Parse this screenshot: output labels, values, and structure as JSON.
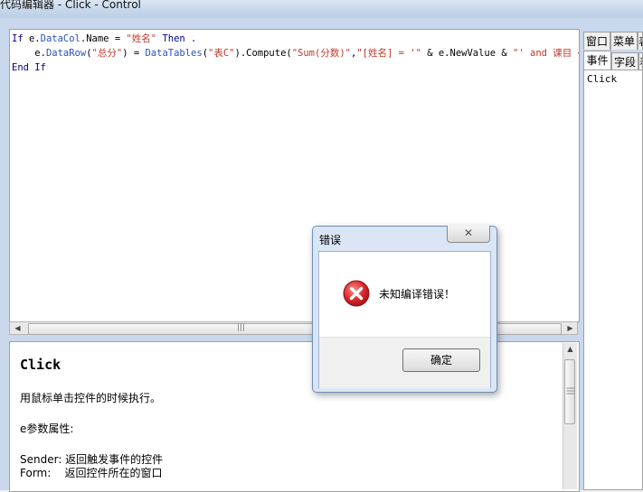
{
  "window": {
    "title": "代码编辑器 - Click - Control"
  },
  "editor": {
    "lines": [
      [
        {
          "t": "If ",
          "c": "kw"
        },
        {
          "t": "e",
          "c": ""
        },
        {
          "t": ".",
          "c": ""
        },
        {
          "t": "DataCol",
          "c": "id"
        },
        {
          "t": ".Name = ",
          "c": ""
        },
        {
          "t": "\"姓名\"",
          "c": "str"
        },
        {
          "t": " Then .",
          "c": "kw"
        }
      ],
      [
        {
          "t": "    e.",
          "c": ""
        },
        {
          "t": "DataRow",
          "c": "id"
        },
        {
          "t": "(",
          "c": ""
        },
        {
          "t": "\"总分\"",
          "c": "str"
        },
        {
          "t": ") = ",
          "c": ""
        },
        {
          "t": "DataTables",
          "c": "id"
        },
        {
          "t": "(",
          "c": ""
        },
        {
          "t": "\"表C\"",
          "c": "str"
        },
        {
          "t": ").Compute(",
          "c": ""
        },
        {
          "t": "\"Sum(分数)\"",
          "c": "str"
        },
        {
          "t": ",",
          "c": ""
        },
        {
          "t": "\"[姓名] = '\"",
          "c": "str"
        },
        {
          "t": " & e.NewValue & ",
          "c": ""
        },
        {
          "t": "\"' and 课目 <>",
          "c": "str"
        }
      ],
      [
        {
          "t": "End If",
          "c": "kw"
        }
      ]
    ]
  },
  "tabs": {
    "row1": [
      "窗口",
      "菜单",
      "表"
    ],
    "row2": [
      "事件",
      "字段",
      "表"
    ]
  },
  "events_list": [
    "Click"
  ],
  "help": {
    "title": "Click",
    "description": "用鼠标单击控件的时候执行。",
    "param_header": "e参数属性:",
    "params": [
      "Sender: 返回触发事件的控件",
      "Form:    返回控件所在的窗口"
    ]
  },
  "dialog": {
    "title": "错误",
    "close_glyph": "✕",
    "message": "未知编译错误！",
    "ok_label": "确定"
  },
  "scrollbar": {
    "grip": "|||"
  },
  "colors": {
    "keyword": "#00008b",
    "identifier": "#2a52be",
    "string": "#c0392b",
    "error_icon": "#d8262c"
  }
}
